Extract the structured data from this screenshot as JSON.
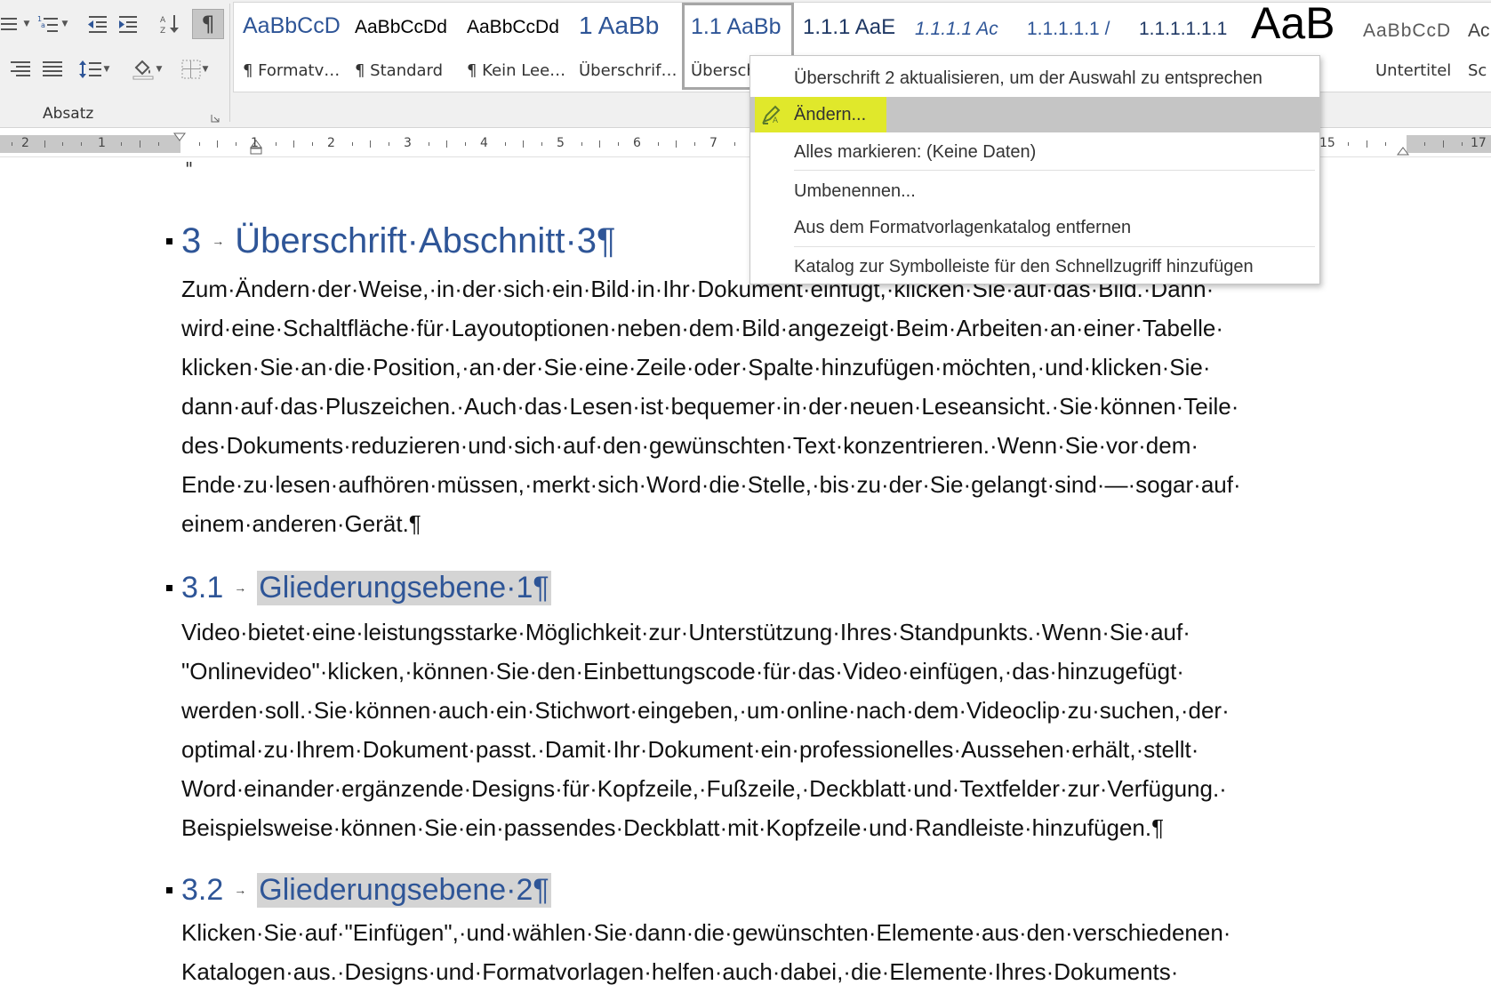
{
  "ribbon": {
    "group_label": "Absatz",
    "styles": [
      {
        "preview": "AaBbCcD",
        "name": "¶ Formatv…"
      },
      {
        "preview": "AaBbCcDd",
        "name": "¶ Standard"
      },
      {
        "preview": "AaBbCcDd",
        "name": "¶ Kein Lee…"
      },
      {
        "preview": "1  AaBb",
        "name": "Überschrif…"
      },
      {
        "preview": "1.1  AaBb",
        "name": "Überschr"
      },
      {
        "preview": "1.1.1  AaE",
        "name": ""
      },
      {
        "preview": "1.1.1.1  Ac",
        "name": ""
      },
      {
        "preview": "1.1.1.1.1  /",
        "name": ""
      },
      {
        "preview": "1.1.1.1.1.1",
        "name": ""
      },
      {
        "preview": "AaB",
        "name": ""
      },
      {
        "preview": "AaBbCcD",
        "name": "Untertitel"
      },
      {
        "preview": "Ac",
        "name": "Sc"
      }
    ]
  },
  "ruler": {
    "numbers": [
      "2",
      "1",
      "1",
      "2",
      "3",
      "4",
      "5",
      "6",
      "7",
      "15",
      "17"
    ]
  },
  "context_menu": {
    "items": [
      "Überschrift 2 aktualisieren, um der Auswahl zu entsprechen",
      "Ändern...",
      "Alles markieren: (Keine Daten)",
      "Umbenennen...",
      "Aus dem Formatvorlagenkatalog entfernen",
      "Katalog zur Symbolleiste für den Schnellzugriff hinzufügen"
    ]
  },
  "document": {
    "top_mark": "\"",
    "headings": [
      {
        "number": "3",
        "text": "Überschrift·Abschnitt·3¶"
      },
      {
        "number": "3.1",
        "text": "Gliederungsebene·1¶"
      },
      {
        "number": "3.2",
        "text": "Gliederungsebene·2¶"
      }
    ],
    "paragraphs": [
      [
        "Zum·Ändern·der·Weise,·in·der·sich·ein·Bild·in·Ihr·Dokument·einfügt,·klicken·Sie·auf·das·Bild.·Dann·",
        "wird·eine·Schaltfläche·für·Layoutoptionen·neben·dem·Bild·angezeigt·Beim·Arbeiten·an·einer·Tabelle·",
        "klicken·Sie·an·die·Position,·an·der·Sie·eine·Zeile·oder·Spalte·hinzufügen·möchten,·und·klicken·Sie·",
        "dann·auf·das·Pluszeichen.·Auch·das·Lesen·ist·bequemer·in·der·neuen·Leseansicht.·Sie·können·Teile·",
        "des·Dokuments·reduzieren·und·sich·auf·den·gewünschten·Text·konzentrieren.·Wenn·Sie·vor·dem·",
        "Ende·zu·lesen·aufhören·müssen,·merkt·sich·Word·die·Stelle,·bis·zu·der·Sie·gelangt·sind·—·sogar·auf·",
        "einem·anderen·Gerät.¶"
      ],
      [
        "Video·bietet·eine·leistungsstarke·Möglichkeit·zur·Unterstützung·Ihres·Standpunkts.·Wenn·Sie·auf·",
        "\"Onlinevideo\"·klicken,·können·Sie·den·Einbettungscode·für·das·Video·einfügen,·das·hinzugefügt·",
        "werden·soll.·Sie·können·auch·ein·Stichwort·eingeben,·um·online·nach·dem·Videoclip·zu·suchen,·der·",
        "optimal·zu·Ihrem·Dokument·passt.·Damit·Ihr·Dokument·ein·professionelles·Aussehen·erhält,·stellt·",
        "Word·einander·ergänzende·Designs·für·Kopfzeile,·Fußzeile,·Deckblatt·und·Textfelder·zur·Verfügung.·",
        "Beispielsweise·können·Sie·ein·passendes·Deckblatt·mit·Kopfzeile·und·Randleiste·hinzufügen.¶"
      ],
      [
        "Klicken·Sie·auf·\"Einfügen\",·und·wählen·Sie·dann·die·gewünschten·Elemente·aus·den·verschiedenen·",
        "Katalogen·aus.·Designs·und·Formatvorlagen·helfen·auch·dabei,·die·Elemente·Ihres·Dokuments·"
      ]
    ]
  },
  "colors": {
    "heading": "#2e5597",
    "menu_highlight": "#e0e82b",
    "ribbon_bg": "#f0f0f0"
  }
}
